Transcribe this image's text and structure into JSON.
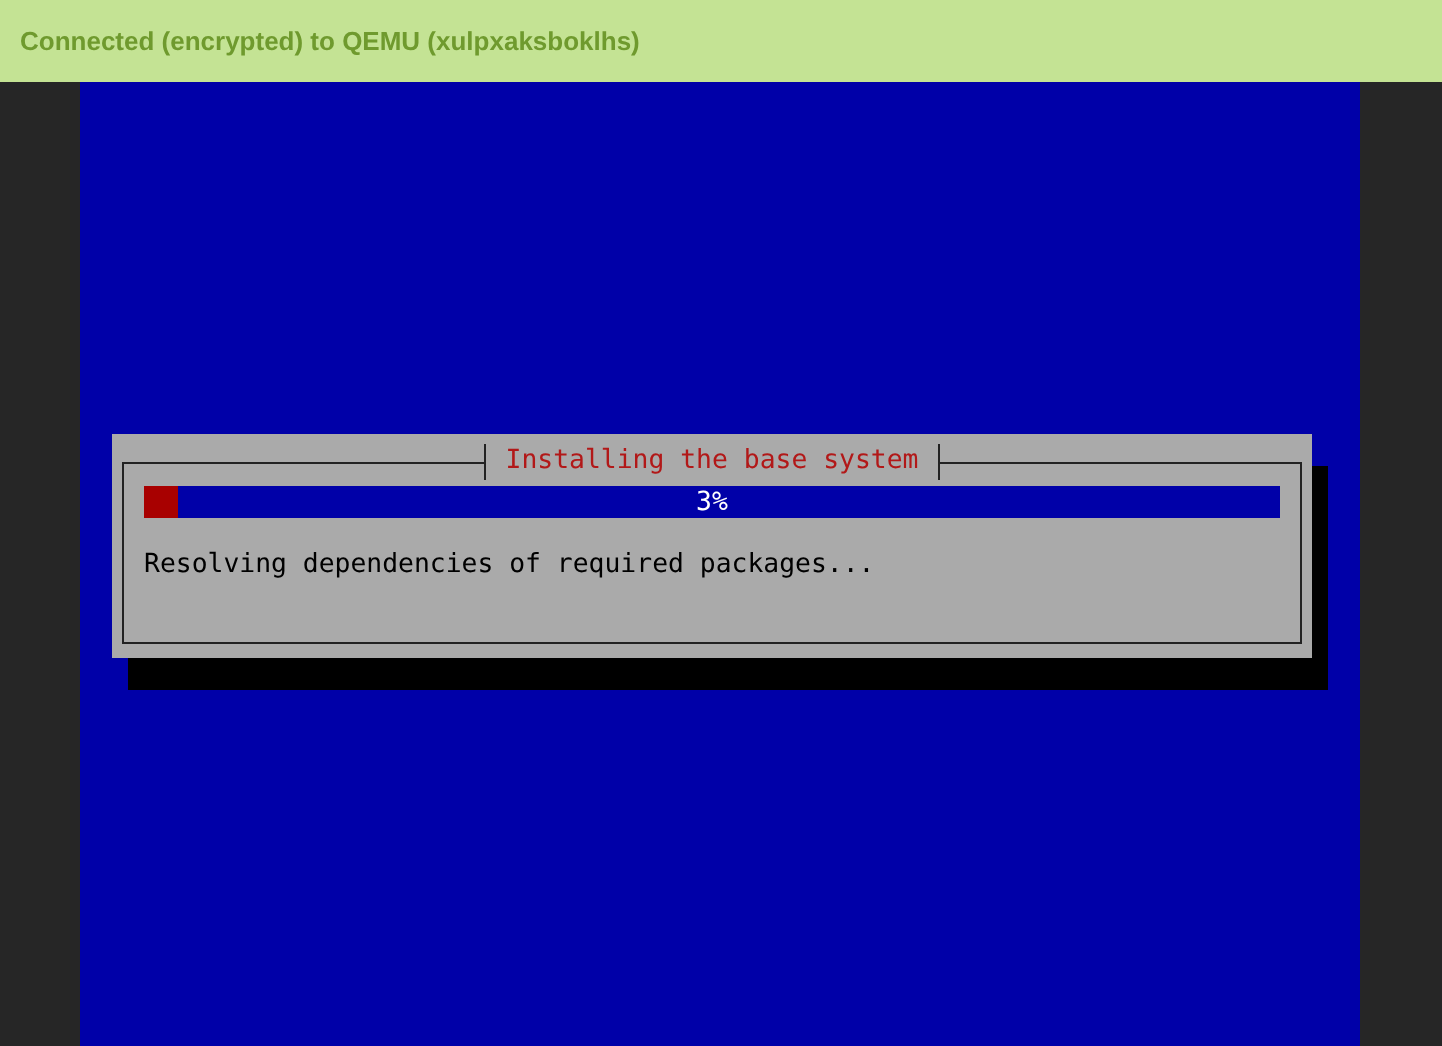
{
  "status_bar": {
    "text": "Connected (encrypted) to QEMU (xulpxaksboklhs)"
  },
  "dialog": {
    "title": "Installing the base system",
    "progress": {
      "level": 0.03,
      "reading": "3%"
    },
    "message": "Resolving dependencies of required packages..."
  }
}
